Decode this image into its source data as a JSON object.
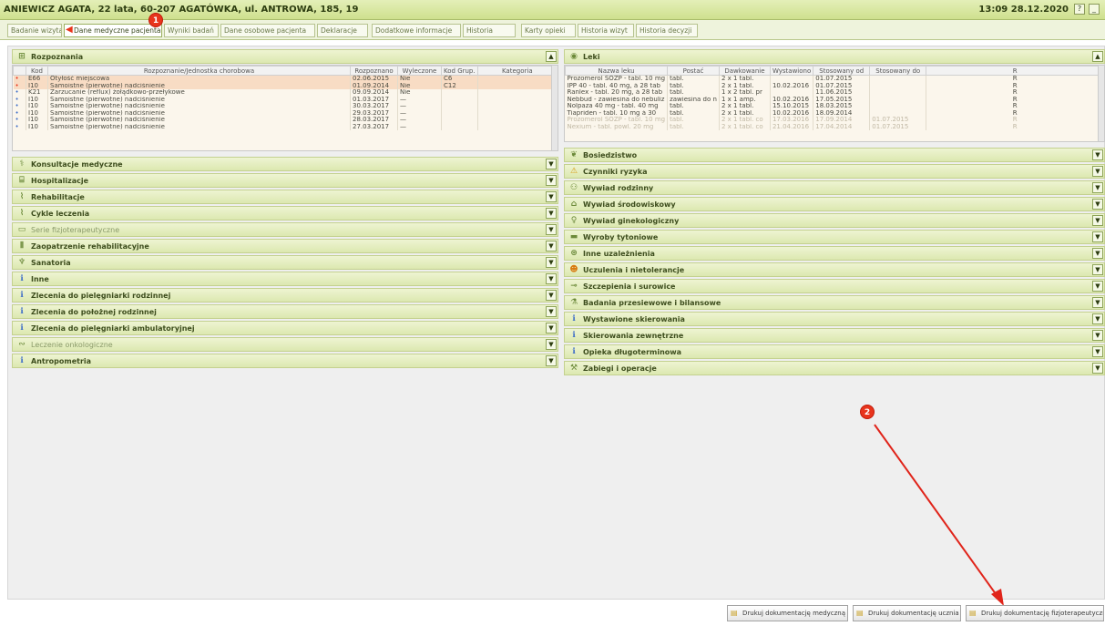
{
  "titlebar": {
    "patient": "ANIEWICZ AGATA, 22 lata, 60-207 AGATÓWKA, ul. ANTROWA, 185, 19",
    "clock": "13:09 28.12.2020",
    "help_btn": "?",
    "minimize_btn": "_"
  },
  "tabs": [
    {
      "label": "Badanie wizyta"
    },
    {
      "label": "Dane medyczne pacjenta"
    },
    {
      "label": "Wyniki badań"
    },
    {
      "label": "Dane osobowe pacjenta"
    },
    {
      "label": "Deklaracje"
    },
    {
      "label": "Dodatkowe informacje"
    },
    {
      "label": "Historia"
    },
    {
      "label": "Karty opieki"
    },
    {
      "label": "Historia wizyt"
    },
    {
      "label": "Historia decyzji"
    }
  ],
  "markers": {
    "one": "1",
    "two": "2"
  },
  "left": {
    "diagnoses": {
      "title": "Rozpoznania",
      "columns": [
        "",
        "Kod",
        "Rozpoznanie/Jednostka chorobowa",
        "Rozpoznano",
        "Wyleczone",
        "Kod Grup.",
        "Kategoria"
      ],
      "rows": [
        [
          "•",
          "E66",
          "Otyłość miejscowa",
          "02.06.2015",
          "Nie",
          "C6",
          ""
        ],
        [
          "•",
          "I10",
          "Samoistne (pierwotne) nadciśnienie",
          "01.09.2014",
          "Nie",
          "C12",
          ""
        ],
        [
          "•",
          "K21",
          "Zarzucanie (reflux) żołądkowo-przełykowe",
          "09.09.2014",
          "Nie",
          "",
          ""
        ],
        [
          "•",
          "I10",
          "Samoistne (pierwotne) nadciśnienie",
          "01.03.2017",
          "—",
          "",
          ""
        ],
        [
          "•",
          "I10",
          "Samoistne (pierwotne) nadciśnienie",
          "30.03.2017",
          "—",
          "",
          ""
        ],
        [
          "•",
          "I10",
          "Samoistne (pierwotne) nadciśnienie",
          "29.03.2017",
          "—",
          "",
          ""
        ],
        [
          "•",
          "I10",
          "Samoistne (pierwotne) nadciśnienie",
          "28.03.2017",
          "—",
          "",
          ""
        ],
        [
          "•",
          "I10",
          "Samoistne (pierwotne) nadciśnienie",
          "27.03.2017",
          "—",
          "",
          ""
        ]
      ]
    },
    "sections": [
      {
        "label": "Konsultacje medyczne",
        "icon": "stethoscope-icon",
        "dim": false
      },
      {
        "label": "Hospitalizacje",
        "icon": "bed-icon",
        "dim": false
      },
      {
        "label": "Rehabilitacje",
        "icon": "chart-icon",
        "dim": false
      },
      {
        "label": "Cykle leczenia",
        "icon": "chart-icon",
        "dim": false
      },
      {
        "label": "Serie fizjoterapeutyczne",
        "icon": "series-icon",
        "dim": true
      },
      {
        "label": "Zaopatrzenie rehabilitacyjne",
        "icon": "crutch-icon",
        "dim": false
      },
      {
        "label": "Sanatoria",
        "icon": "sanatorium-icon",
        "dim": false
      },
      {
        "label": "Inne",
        "icon": "info-icon",
        "dim": false
      },
      {
        "label": "Zlecenia do pielęgniarki rodzinnej",
        "icon": "info-icon",
        "dim": false
      },
      {
        "label": "Zlecenia do położnej rodzinnej",
        "icon": "info-icon",
        "dim": false
      },
      {
        "label": "Zlecenia do pielęgniarki ambulatoryjnej",
        "icon": "info-icon",
        "dim": false
      },
      {
        "label": "Leczenie onkologiczne",
        "icon": "ribbon-icon",
        "dim": true
      },
      {
        "label": "Antropometria",
        "icon": "info-icon",
        "dim": false
      }
    ]
  },
  "right": {
    "drugs": {
      "title": "Leki",
      "columns": [
        "Nazwa leku",
        "Postać",
        "Dawkowanie",
        "Wystawiono",
        "Stosowany od",
        "Stosowany do",
        "R"
      ],
      "rows": [
        [
          "Prozomerol SOZP - tabl. 10 mg",
          "tabl.",
          "2 x 1 tabl.",
          "",
          "01.07.2015",
          "",
          "R"
        ],
        [
          "IPP 40 - tabl. 40 mg, à 28 tab",
          "tabl.",
          "2 x 1 tabl.",
          "10.02.2016",
          "01.07.2015",
          "",
          "R"
        ],
        [
          "Ranlex - tabl. 20 mg, à 28 tab",
          "tabl.",
          "1 x 2 tabl. pr",
          "",
          "11.06.2015",
          "",
          "R"
        ],
        [
          "Nebbud - zawiesina do nebuliz",
          "zawiesina do n",
          "1 x 1 amp.",
          "10.02.2016",
          "17.05.2015",
          "",
          "R"
        ],
        [
          "Nolpaza 40 mg - tabl. 40 mg",
          "tabl.",
          "2 x 1 tabl.",
          "15.10.2015",
          "18.03.2015",
          "",
          "R"
        ],
        [
          "Tiapriden - tabl. 10 mg à 30",
          "tabl.",
          "2 x 1 tabl.",
          "10.02.2016",
          "18.09.2014",
          "",
          "R"
        ],
        [
          "Prozomerol SOZP - tabl. 10 mg",
          "tabl.",
          "2 x 1 tabl. co",
          "17.03.2016",
          "17.09.2014",
          "01.07.2015",
          "R"
        ],
        [
          "Nexium - tabl. powl. 20 mg",
          "tabl.",
          "2 x 1 tabl. co",
          "21.04.2016",
          "17.04.2014",
          "01.07.2015",
          "R"
        ]
      ]
    },
    "sections": [
      {
        "label": "Bosiedzistwo",
        "icon": "leaf-icon"
      },
      {
        "label": "Czynniki ryzyka",
        "icon": "warning-icon"
      },
      {
        "label": "Wywiad rodzinny",
        "icon": "family-icon"
      },
      {
        "label": "Wywiad środowiskowy",
        "icon": "home-icon"
      },
      {
        "label": "Wywiad ginekologiczny",
        "icon": "person-icon"
      },
      {
        "label": "Wyroby tytoniowe",
        "icon": "cigarette-icon"
      },
      {
        "label": "Inne uzależnienia",
        "icon": "pill-icon"
      },
      {
        "label": "Uczulenia i nietolerancje",
        "icon": "allergy-icon"
      },
      {
        "label": "Szczepienia i surowice",
        "icon": "syringe-icon"
      },
      {
        "label": "Badania przesiewowe i bilansowe",
        "icon": "test-icon"
      },
      {
        "label": "Wystawione skierowania",
        "icon": "info-icon"
      },
      {
        "label": "Skierowania zewnętrzne",
        "icon": "info-icon"
      },
      {
        "label": "Opieka długoterminowa",
        "icon": "info-icon"
      },
      {
        "label": "Zabiegi i operacje",
        "icon": "scalpel-icon"
      }
    ]
  },
  "buttons": {
    "print_medical": "Drukuj dokumentację medyczną",
    "print_dental": "Drukuj dokumentację ucznia",
    "print_physio": "Drukuj dokumentację fizjoterapeutyczną"
  }
}
